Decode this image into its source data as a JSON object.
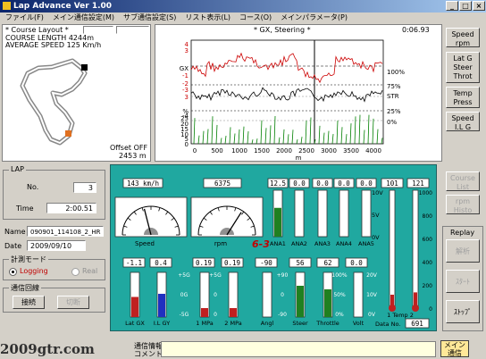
{
  "window": {
    "title": "Lap Advance   Ver 1.00"
  },
  "menu": [
    "ファイル(F)",
    "メイン通信設定(M)",
    "サブ通信設定(S)",
    "リスト表示(L)",
    "コース(O)",
    "メインパラメータ(P)"
  ],
  "course": {
    "title": "* Course Layout *",
    "length_line": "COURSE LENGTH  4244m",
    "speed_line": "AVERAGE SPEED  125 Km/h",
    "offset": "Offset OFF",
    "distance": "2453 m"
  },
  "chart_header": {
    "title": "*   GX, Steering   *",
    "time": "0:06.93"
  },
  "chart_data": {
    "type": "line",
    "x_ticks": [
      "0",
      "500",
      "1000",
      "1500",
      "2000",
      "2500",
      "3000",
      "3500",
      "4000"
    ],
    "xlabel": "m",
    "panels": [
      {
        "y_ticks": [
          "4",
          "3",
          "GX",
          "-1",
          "-2",
          "-3"
        ],
        "right_labels": [
          "100%",
          "75%"
        ]
      },
      {
        "y_ticks": [
          "3",
          "-4"
        ],
        "right_labels": [
          "STR",
          "25%"
        ]
      },
      {
        "y_ticks": [
          "%",
          "25",
          "20",
          "15",
          "10",
          "5",
          "0"
        ],
        "right_labels": [
          "0%"
        ]
      }
    ],
    "series": [
      {
        "color": "#cc0000"
      },
      {
        "color": "#000000"
      },
      {
        "color": "#008000"
      }
    ]
  },
  "right_buttons": [
    {
      "label": "Speed\nrpm",
      "disabled": false
    },
    {
      "label": "Lat G\nSteer\nThrot",
      "disabled": false
    },
    {
      "label": "Temp\nPress",
      "disabled": false
    },
    {
      "label": "Speed\nI.L G",
      "disabled": false
    }
  ],
  "course_buttons": [
    {
      "label": "Course\nList"
    },
    {
      "label": "rpm\nHisto"
    }
  ],
  "replay": {
    "title": "Replay",
    "buttons": [
      "解析",
      "ｽﾀｰﾄ",
      "ｽﾄｯﾌﾟ"
    ]
  },
  "lap": {
    "group": "LAP",
    "no_label": "No.",
    "no_value": "3",
    "time_label": "Time",
    "time_value": "2:00.51",
    "name_label": "Name",
    "name_value": "090901_114108_2_HR",
    "date_label": "Date",
    "date_value": "2009/09/10",
    "mode_group": "計測モード",
    "logging": "Logging",
    "real": "Real",
    "comm_group": "通信回線",
    "connect": "接続",
    "disconnect": "切断"
  },
  "dash": {
    "speed": "143 km/h",
    "rpm": "6375",
    "ana_vals": [
      "12.5",
      "0.0",
      "0.0",
      "0.0",
      "0.0"
    ],
    "temps": [
      "101",
      "121"
    ],
    "gauge_labels": [
      "Speed",
      "rpm"
    ],
    "gear": "6-3",
    "ana_labels": [
      "ANA1",
      "ANA2",
      "ANA3",
      "ANA4",
      "ANA5"
    ],
    "v_scale": [
      "10V",
      "5V",
      "0V"
    ],
    "temp_scale": [
      "1000",
      "800",
      "600",
      "400",
      "200",
      "0"
    ],
    "bot_vals": [
      "-1.1",
      "0.4",
      "0.19",
      "0.19",
      "-90",
      "56",
      "62",
      "0.0"
    ],
    "bot_labels": [
      "Lat GX",
      "I.L GY",
      "1 MPa",
      "2 MPa",
      "Angl",
      "Steer",
      "Throttle",
      "Volt"
    ],
    "temp_label": "1 Temp 2",
    "data_no_label": "Data No.",
    "data_no": "691",
    "g_scale": [
      "+5G",
      "0G",
      "-5G"
    ],
    "mpa_scale": [
      "+5G",
      "0",
      "0"
    ],
    "angl_scale": [
      "+90",
      "-90"
    ],
    "steer_scale": [
      "+90",
      "0",
      "-90"
    ],
    "pct_scale": [
      "100%",
      "50%",
      "0%"
    ],
    "volt_scale": [
      "20V",
      "10V",
      "0V"
    ],
    "levels": {
      "ana": [
        0.62,
        0,
        0,
        0,
        0
      ],
      "temp": [
        0.1,
        0.12
      ],
      "bars": [
        0.45,
        0.52,
        0.2,
        0.2,
        0.0,
        0.7,
        0.62,
        0.0
      ]
    }
  },
  "status": {
    "label_top": "通信情報",
    "label_bot": "コメント",
    "button": "メイン\n通信",
    "brand": "2009gtr.com"
  }
}
